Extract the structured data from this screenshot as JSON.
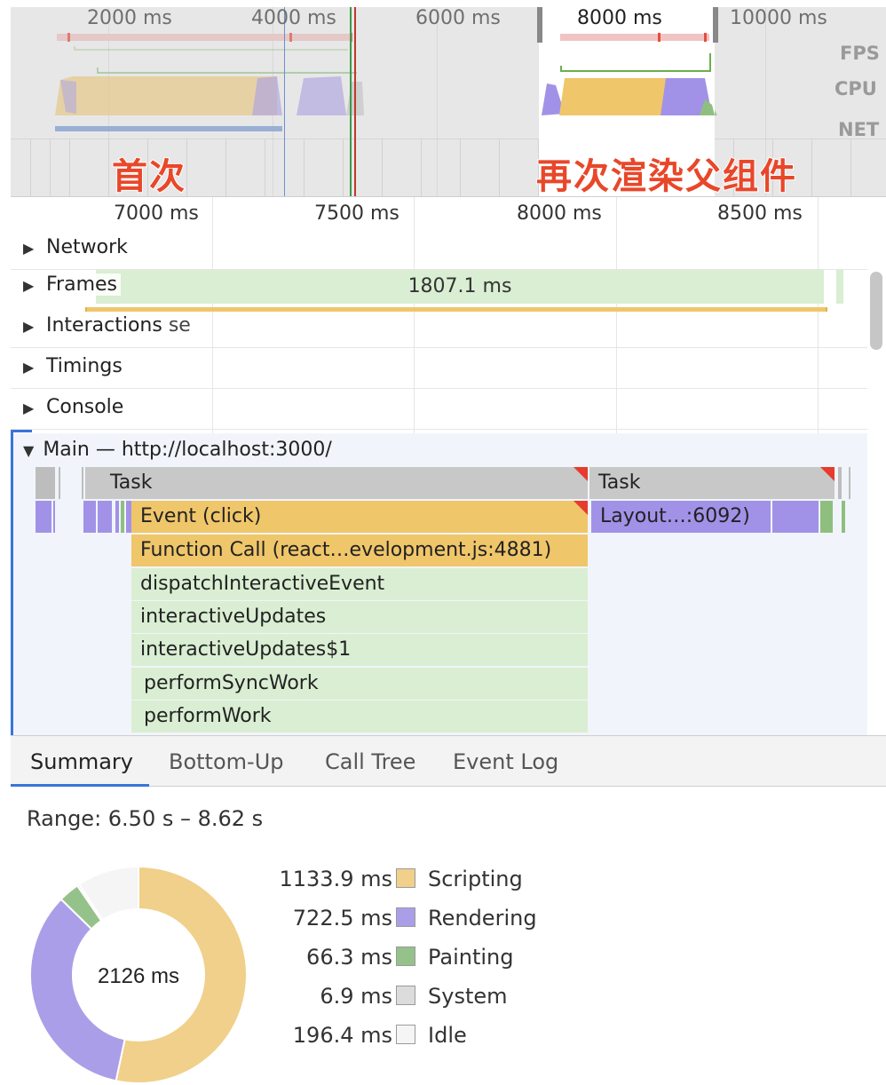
{
  "overview": {
    "ticks": [
      "2000 ms",
      "4000 ms",
      "6000 ms",
      "8000 ms",
      "10000 ms"
    ],
    "lanes": [
      "FPS",
      "CPU",
      "NET"
    ],
    "annotations": {
      "first": "首次",
      "rerender": "再次渲染父组件"
    }
  },
  "timeline": {
    "ticks": [
      "7000 ms",
      "7500 ms",
      "8000 ms",
      "8500 ms"
    ],
    "tracks": [
      {
        "label": "Network",
        "expanded": false
      },
      {
        "label": "Frames",
        "expanded": false
      },
      {
        "label": "Interactions",
        "expanded": false
      },
      {
        "label": "Timings",
        "expanded": false
      },
      {
        "label": "Console",
        "expanded": false
      }
    ],
    "frames_duration": "1807.1 ms",
    "interactions_trailing": "se",
    "main": {
      "label": "Main — http://localhost:3000/",
      "expanded": true,
      "blocks": [
        {
          "name": "Task",
          "type": "task"
        },
        {
          "name": "Task",
          "type": "task"
        },
        {
          "name": "Event (click)",
          "type": "script"
        },
        {
          "name": "Layout…:6092)",
          "type": "render"
        },
        {
          "name": "Function Call (react…evelopment.js:4881)",
          "type": "script"
        },
        {
          "name": "dispatchInteractiveEvent",
          "type": "js"
        },
        {
          "name": "interactiveUpdates",
          "type": "js"
        },
        {
          "name": "interactiveUpdates$1",
          "type": "js"
        },
        {
          "name": "performSyncWork",
          "type": "js"
        },
        {
          "name": "performWork",
          "type": "js"
        }
      ]
    }
  },
  "tabs": [
    {
      "label": "Summary",
      "active": true
    },
    {
      "label": "Bottom-Up",
      "active": false
    },
    {
      "label": "Call Tree",
      "active": false
    },
    {
      "label": "Event Log",
      "active": false
    }
  ],
  "summary": {
    "range": "Range: 6.50 s – 8.62 s",
    "total": "2126 ms",
    "categories": [
      {
        "label": "Scripting",
        "value_text": "1133.9 ms",
        "value": 1133.9,
        "color": "#f0d08a"
      },
      {
        "label": "Rendering",
        "value_text": "722.5 ms",
        "value": 722.5,
        "color": "#ab9ee8"
      },
      {
        "label": "Painting",
        "value_text": "66.3 ms",
        "value": 66.3,
        "color": "#95c28a"
      },
      {
        "label": "System",
        "value_text": "6.9 ms",
        "value": 6.9,
        "color": "#dcdcdc"
      },
      {
        "label": "Idle",
        "value_text": "196.4 ms",
        "value": 196.4,
        "color": "#f5f5f5"
      }
    ]
  },
  "colors": {
    "scripting": "#f0c66a",
    "rendering": "#a192e8",
    "painting": "#8fbf7f",
    "js_frames": "#d9eed2",
    "accent": "#3a74d9",
    "long_task": "#e63b2e",
    "annotation": "#e8472a"
  }
}
